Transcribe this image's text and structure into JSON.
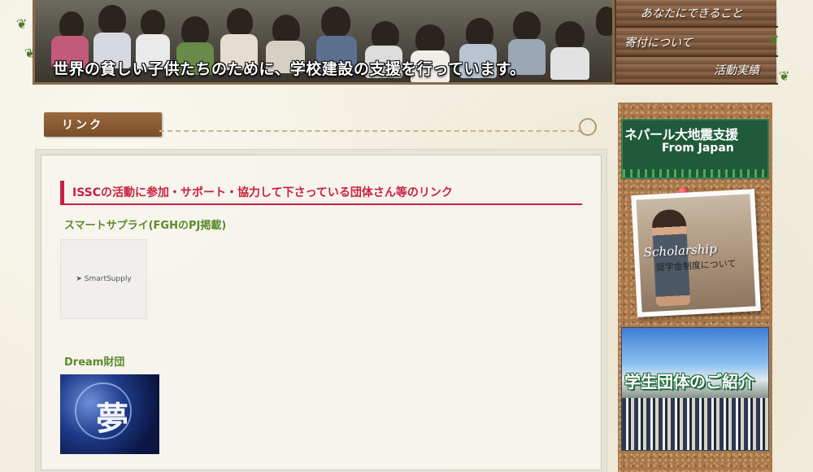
{
  "header": {
    "slogan": "世界の貧しい子供たちのために、学校建設の支援を行っています。",
    "nav": [
      {
        "label": "あなたにできること"
      },
      {
        "label": "寄付について"
      },
      {
        "label": "活動実績"
      }
    ]
  },
  "section": {
    "ribbon_label": "リンク"
  },
  "content": {
    "heading": "ISSCの活動に参加・サポート・協力して下さっている団体さん等のリンク",
    "links": [
      {
        "title": "スマートサプライ(FGHのPJ掲載)",
        "logo_text": "SmartSupply"
      },
      {
        "title": "Dream財団",
        "logo_text": "夢"
      }
    ]
  },
  "sidebar": {
    "nepal": {
      "line1": "ネパール大地震支援",
      "line2": "From Japan"
    },
    "scholarship": {
      "title": "Scholarship",
      "subtitle": "奨学金制度について"
    },
    "students": {
      "label": "学生団体のご紹介"
    }
  }
}
